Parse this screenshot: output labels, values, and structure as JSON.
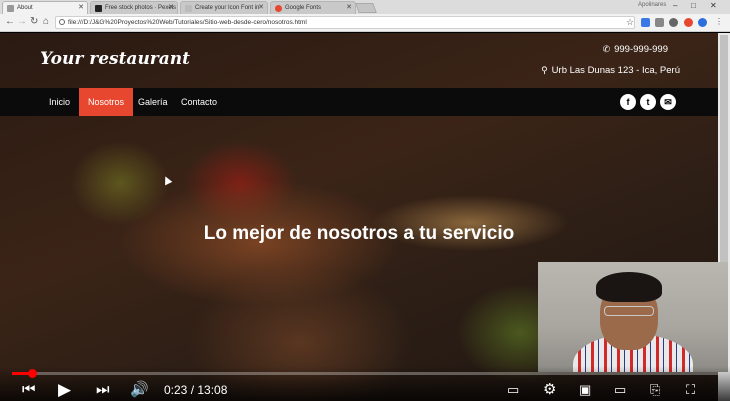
{
  "browser": {
    "tabs": [
      {
        "title": "About",
        "active": true
      },
      {
        "title": "Free stock photos · Pexels",
        "active": false
      },
      {
        "title": "Create your Icon Font in",
        "active": false
      },
      {
        "title": "Google Fonts",
        "active": false
      }
    ],
    "user_label": "Apolinares",
    "url": "file:///D:/J&G%20Proyectos%20Web/Tutoriales/Sitio-web-desde-cero/nosotros.html"
  },
  "site": {
    "logo": "Your restaurant",
    "phone": "999-999-999",
    "address": "Urb Las Dunas 123 - Ica, Perú",
    "nav": [
      "Inicio",
      "Nosotros",
      "Galería",
      "Contacto"
    ],
    "active_nav": "Nosotros",
    "social": [
      "facebook",
      "twitter",
      "email"
    ],
    "hero_title": "Lo mejor de nosotros a tu servicio",
    "accent_color": "#e8472f"
  },
  "player": {
    "current_time": "0:23",
    "duration": "13:08",
    "time_display": "0:23 / 13:08",
    "progress_fraction": 0.029,
    "accent_color": "#ff0000"
  }
}
